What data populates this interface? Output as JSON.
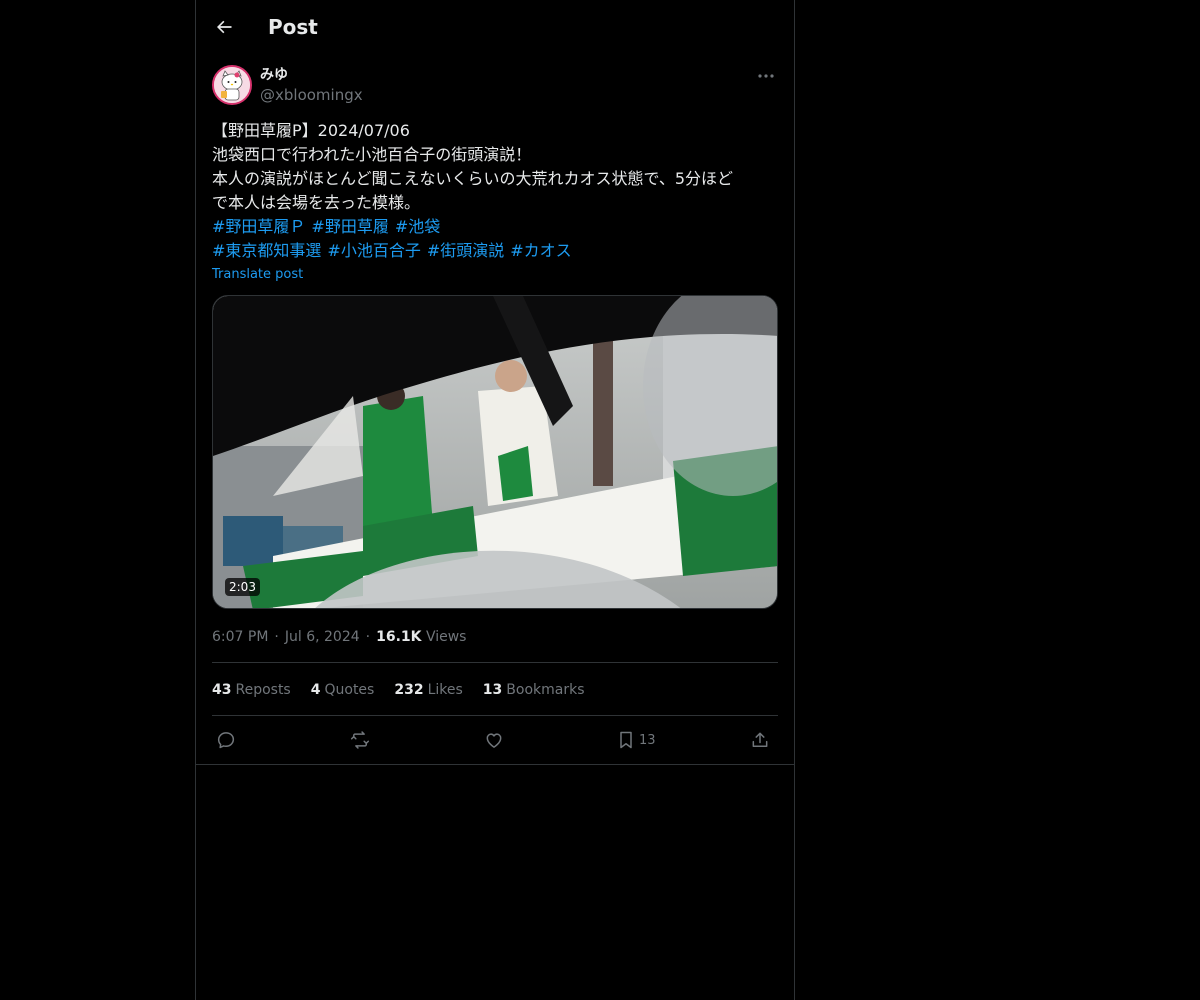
{
  "header": {
    "title": "Post"
  },
  "author": {
    "display_name": "みゆ",
    "handle": "@xbloomingx"
  },
  "post": {
    "lines": [
      "【野田草履P】2024/07/06",
      "池袋西口で行われた小池百合子の街頭演説！",
      "本人の演説がほとんど聞こえないくらいの大荒れカオス状態で、5分ほど",
      "で本人は会場を去った模様。"
    ],
    "hashtags_line1": [
      "#野田草履Ｐ",
      "#野田草履",
      "#池袋"
    ],
    "hashtags_line2": [
      "#東京都知事選",
      "#小池百合子",
      "#街頭演説",
      "#カオス"
    ],
    "translate_label": "Translate post",
    "video_duration": "2:03",
    "time": "6:07 PM",
    "date": "Jul 6, 2024",
    "views_count": "16.1K",
    "views_label": "Views"
  },
  "stats": {
    "reposts_count": "43",
    "reposts_label": "Reposts",
    "quotes_count": "4",
    "quotes_label": "Quotes",
    "likes_count": "232",
    "likes_label": "Likes",
    "bookmarks_count": "13",
    "bookmarks_label": "Bookmarks"
  },
  "actions": {
    "bookmark_count": "13"
  },
  "icons": {
    "back": "arrow-left-icon",
    "more": "more-horizontal-icon",
    "reply": "reply-icon",
    "repost": "repost-icon",
    "like": "heart-icon",
    "bookmark": "bookmark-icon",
    "share": "share-icon"
  },
  "colors": {
    "background": "#000000",
    "text": "#e7e9ea",
    "muted": "#71767b",
    "accent": "#1d9bf0",
    "border": "#2f3336"
  }
}
